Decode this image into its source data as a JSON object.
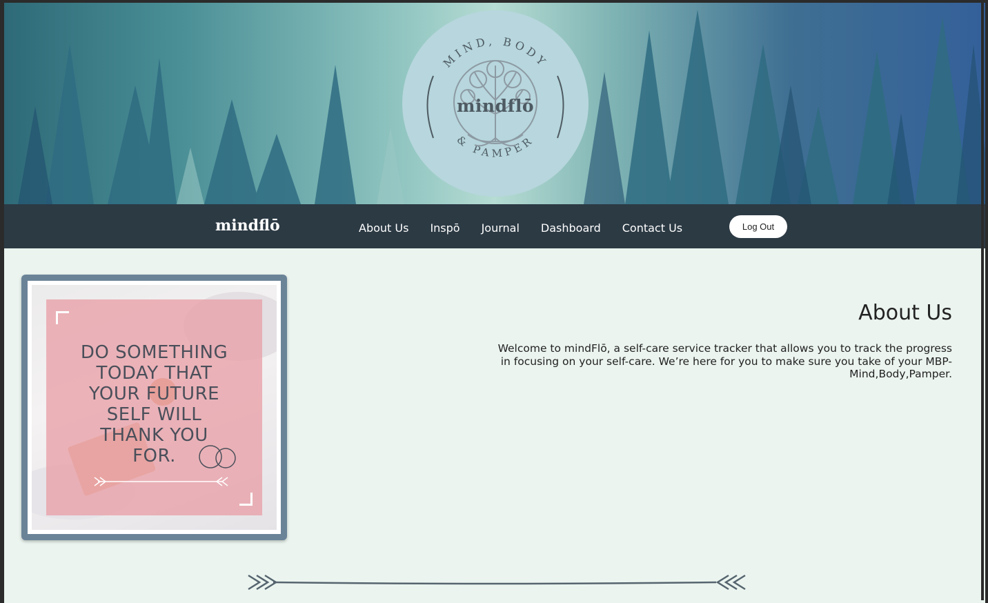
{
  "hero": {
    "badge_top_text": "MIND, BODY",
    "badge_bottom_text": "& PAMPER",
    "badge_title": "mindflō"
  },
  "nav": {
    "brand": "mindflō",
    "items": [
      {
        "label": "About Us"
      },
      {
        "label": "Inspō"
      },
      {
        "label": "Journal"
      },
      {
        "label": "Dashboard"
      },
      {
        "label": "Contact Us"
      }
    ],
    "logout_label": "Log Out"
  },
  "card": {
    "quote_lines": [
      "DO SOMETHING",
      "TODAY THAT",
      "YOUR FUTURE",
      "SELF WILL",
      "THANK YOU",
      "FOR."
    ]
  },
  "about": {
    "heading": "About Us",
    "body": "Welcome to mindFlō, a self-care service tracker that allows you to track the progress in focusing on your self-care. We’re here for you to make sure you take of your MBP-Mind,Body,Pamper."
  },
  "colors": {
    "nav_bg": "#2c3a44",
    "page_bg": "#ebf4ef",
    "badge_bg": "#b7d6dd",
    "card_border": "#6a8397",
    "quote_overlay": "#e8a0a8"
  },
  "icons": {
    "tree_logo": "tree-of-life-icon",
    "divider": "arrow-divider-icon"
  }
}
